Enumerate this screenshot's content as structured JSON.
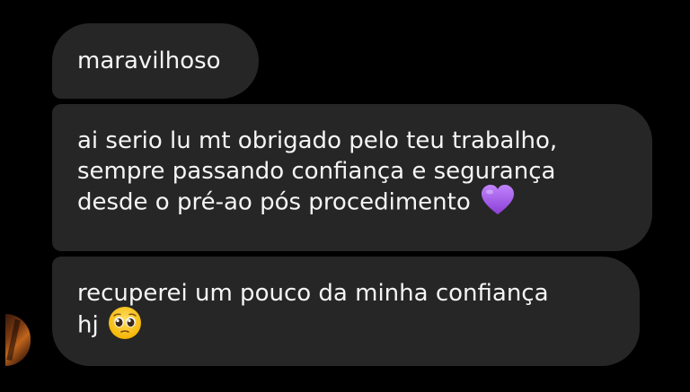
{
  "messages": [
    {
      "lines": [
        "maravilhoso"
      ]
    },
    {
      "lines": [
        "ai serio lu mt obrigado pelo teu trabalho,",
        "sempre passando confiança e segurança",
        "desde o pré-ao pós procedimento"
      ],
      "emoji": "purple-heart"
    },
    {
      "lines": [
        "recuperei um pouco da minha confiança",
        "hj"
      ],
      "emoji": "pleading-face"
    }
  ],
  "colors": {
    "background": "#000000",
    "bubble": "#262626",
    "text": "#f5f5f5",
    "heart": "#a757e6"
  }
}
